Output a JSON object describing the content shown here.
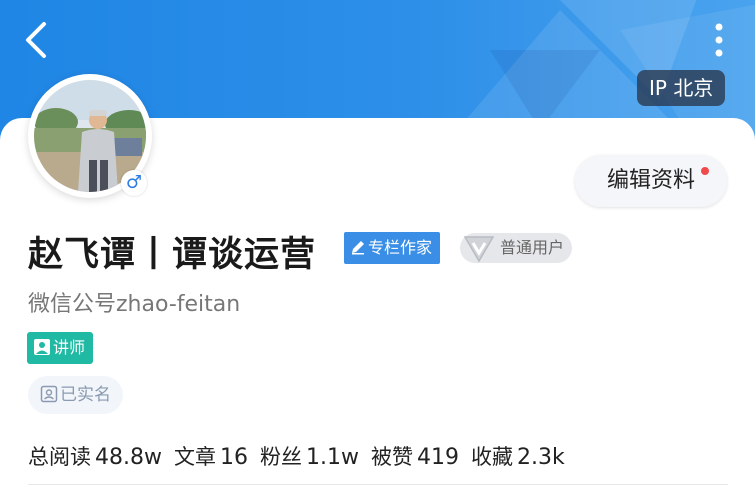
{
  "header": {
    "ip_label": "IP 北京"
  },
  "profile": {
    "name": "赵飞谭丨谭谈运营",
    "badge_writer": "专栏作家",
    "badge_user": "普通用户",
    "wechat": "微信公号zhao-feitan",
    "lecturer": "讲师",
    "verified": "已实名",
    "gender_symbol": "♂",
    "edit_button": "编辑资料"
  },
  "stats": [
    {
      "label": "总阅读",
      "value": "48.8w"
    },
    {
      "label": "文章",
      "value": "16"
    },
    {
      "label": "粉丝",
      "value": "1.1w"
    },
    {
      "label": "被赞",
      "value": "419"
    },
    {
      "label": "收藏",
      "value": "2.3k"
    }
  ],
  "colors": {
    "header_blue": "#2d8fe8",
    "writer_badge": "#3a8ee6",
    "lecturer_badge": "#20b9a3",
    "notification_dot": "#f04a4a"
  }
}
